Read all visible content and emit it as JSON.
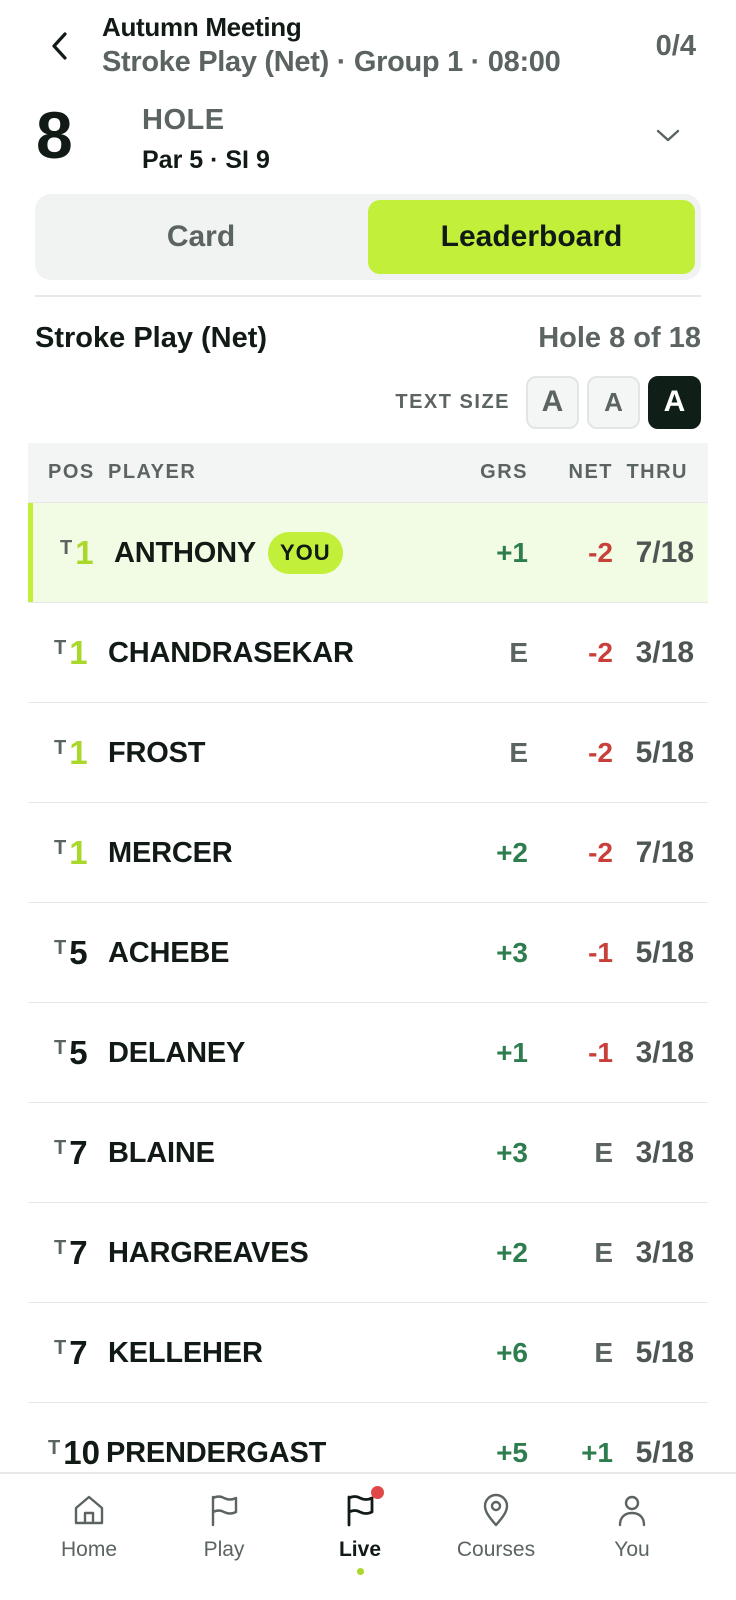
{
  "header": {
    "title": "Autumn Meeting",
    "subtitle": "Stroke Play (Net) · Group 1 · 08:00",
    "progress": "0/4"
  },
  "hole": {
    "number": "8",
    "label": "HOLE",
    "meta": "Par 5 · SI 9"
  },
  "tabs": {
    "card": "Card",
    "leaderboard": "Leaderboard",
    "active": "leaderboard"
  },
  "section": {
    "title": "Stroke Play (Net)",
    "hole_progress": "Hole 8 of 18"
  },
  "text_size": {
    "label": "TEXT SIZE",
    "small": "A",
    "medium": "A",
    "large": "A",
    "selected": "large"
  },
  "table": {
    "headers": {
      "pos": "POS",
      "player": "PLAYER",
      "grs": "GRS",
      "net": "NET",
      "thru": "THRU"
    },
    "rows": [
      {
        "tie": "T",
        "pos": "1",
        "player": "ANTHONY",
        "badge": "YOU",
        "grs": "+1",
        "net": "-2",
        "thru": "7/18"
      },
      {
        "tie": "T",
        "pos": "1",
        "player": "CHANDRASEKAR",
        "grs": "E",
        "net": "-2",
        "thru": "3/18"
      },
      {
        "tie": "T",
        "pos": "1",
        "player": "FROST",
        "grs": "E",
        "net": "-2",
        "thru": "5/18"
      },
      {
        "tie": "T",
        "pos": "1",
        "player": "MERCER",
        "grs": "+2",
        "net": "-2",
        "thru": "7/18"
      },
      {
        "tie": "T",
        "pos": "5",
        "player": "ACHEBE",
        "grs": "+3",
        "net": "-1",
        "thru": "5/18"
      },
      {
        "tie": "T",
        "pos": "5",
        "player": "DELANEY",
        "grs": "+1",
        "net": "-1",
        "thru": "3/18"
      },
      {
        "tie": "T",
        "pos": "7",
        "player": "BLAINE",
        "grs": "+3",
        "net": "E",
        "thru": "3/18"
      },
      {
        "tie": "T",
        "pos": "7",
        "player": "HARGREAVES",
        "grs": "+2",
        "net": "E",
        "thru": "3/18"
      },
      {
        "tie": "T",
        "pos": "7",
        "player": "KELLEHER",
        "grs": "+6",
        "net": "E",
        "thru": "5/18"
      },
      {
        "tie": "T",
        "pos": "10",
        "player": "PRENDERGAST",
        "grs": "+5",
        "net": "+1",
        "thru": "5/18"
      }
    ]
  },
  "nav": {
    "items": [
      {
        "label": "Home",
        "icon": "home-icon"
      },
      {
        "label": "Play",
        "icon": "flag-icon"
      },
      {
        "label": "Live",
        "icon": "flag-icon"
      },
      {
        "label": "Courses",
        "icon": "map-pin-icon"
      },
      {
        "label": "You",
        "icon": "user-icon"
      }
    ],
    "active": "Live"
  },
  "colors": {
    "accent": "#c2f03a",
    "leader_position": "#a9d82a",
    "over_par": "#2e7d4f",
    "under_par": "#c9403a",
    "notification_dot": "#e04848"
  }
}
